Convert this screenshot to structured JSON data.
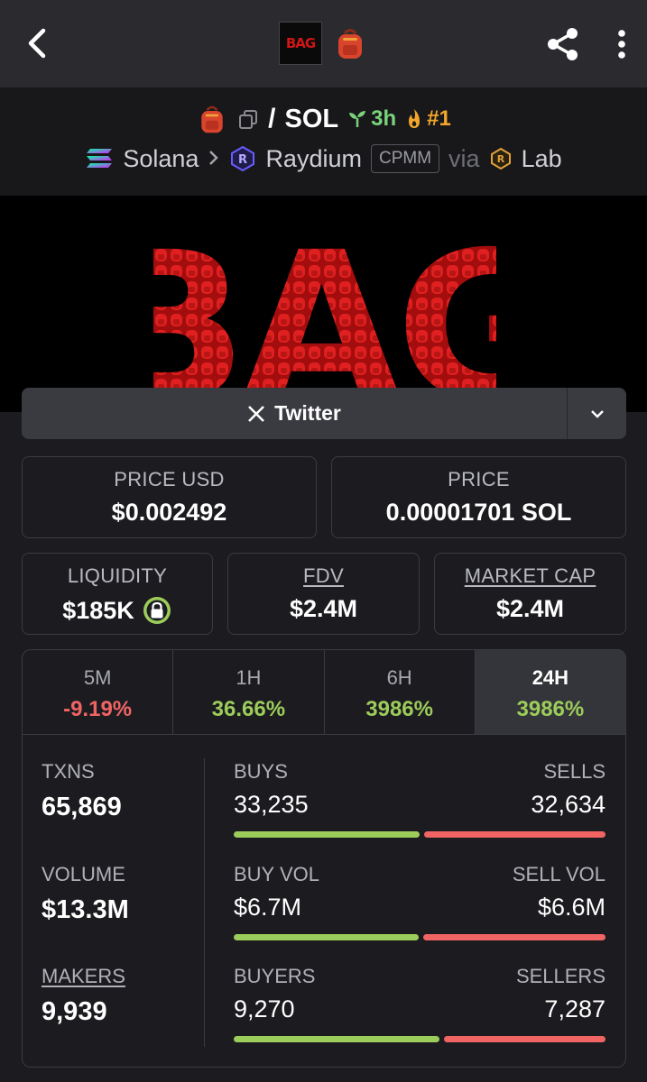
{
  "topbar": {
    "logo_text": "BAG"
  },
  "pair": {
    "separator": "/",
    "quote": "SOL",
    "age": "3h",
    "rank": "#1",
    "chain": "Solana",
    "dex": "Raydium",
    "pool_type": "CPMM",
    "via": "via",
    "via_name": "Lab"
  },
  "banner": {
    "text": "BAG"
  },
  "twitter": {
    "label": "Twitter"
  },
  "prices": {
    "price_usd_label": "PRICE USD",
    "price_usd": "$0.002492",
    "price_label": "PRICE",
    "price": "0.00001701 SOL"
  },
  "metrics": {
    "liquidity_label": "LIQUIDITY",
    "liquidity": "$185K",
    "fdv_label": "FDV",
    "fdv": "$2.4M",
    "mcap_label": "MARKET CAP",
    "mcap": "$2.4M"
  },
  "tabs": [
    {
      "label": "5M",
      "value": "-9.19%"
    },
    {
      "label": "1H",
      "value": "36.66%"
    },
    {
      "label": "6H",
      "value": "3986%"
    },
    {
      "label": "24H",
      "value": "3986%"
    }
  ],
  "stats": {
    "txns_label": "TXNS",
    "txns": "65,869",
    "volume_label": "VOLUME",
    "volume": "$13.3M",
    "makers_label": "MAKERS",
    "makers": "9,939",
    "buys_label": "BUYS",
    "buys": "33,235",
    "sells_label": "SELLS",
    "sells": "32,634",
    "buys_share": 0.505,
    "buyvol_label": "BUY VOL",
    "buyvol": "$6.7M",
    "sellvol_label": "SELL VOL",
    "sellvol": "$6.6M",
    "buyvol_share": 0.504,
    "buyers_label": "BUYERS",
    "buyers": "9,270",
    "sellers_label": "SELLERS",
    "sellers": "7,287",
    "buyers_share": 0.56
  },
  "colors": {
    "positive": "#9ccc5a",
    "negative": "#f06464",
    "banner_red": "#d81a1a"
  }
}
